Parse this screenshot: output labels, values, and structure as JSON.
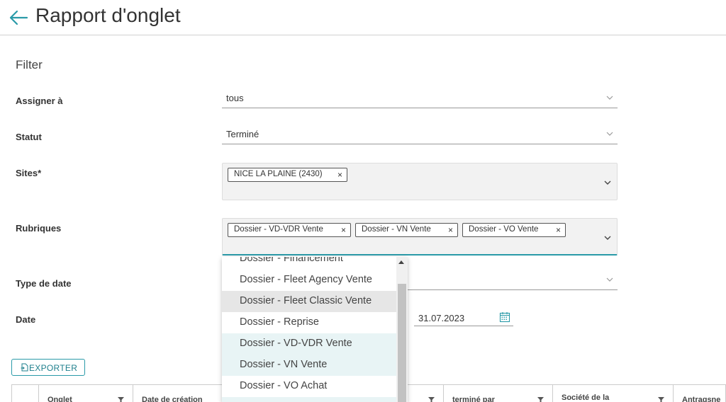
{
  "header": {
    "title": "Rapport d'onglet"
  },
  "filter": {
    "title": "Filter",
    "assigner": {
      "label": "Assigner à",
      "value": "tous"
    },
    "statut": {
      "label": "Statut",
      "value": "Terminé"
    },
    "sites": {
      "label": "Sites*",
      "chips": [
        "NICE LA PLAINE (2430)"
      ]
    },
    "rubriques": {
      "label": "Rubriques",
      "chips": [
        "Dossier - VD-VDR Vente",
        "Dossier - VN Vente",
        "Dossier - VO Vente"
      ]
    },
    "type_de_date": {
      "label": "Type de date"
    },
    "date": {
      "label": "Date",
      "to": "31.07.2023"
    }
  },
  "dropdown": {
    "options": [
      "Dossier - Financement",
      "Dossier - Fleet Agency Vente",
      "Dossier - Fleet Classic Vente",
      "Dossier - Reprise",
      "Dossier - VD-VDR Vente",
      "Dossier - VN Vente",
      "Dossier - VO Achat"
    ]
  },
  "export": {
    "label": "EXPORTER"
  },
  "grid": {
    "columns": [
      {
        "label": "Onglet"
      },
      {
        "label": "Date de création"
      },
      {
        "label": "terminé par"
      },
      {
        "label": "Société de la"
      },
      {
        "label": "Antragsne"
      }
    ]
  },
  "colors": {
    "accent": "#2a9aa8",
    "chip_border": "#555555",
    "selected_bg": "#e8f4f5"
  }
}
